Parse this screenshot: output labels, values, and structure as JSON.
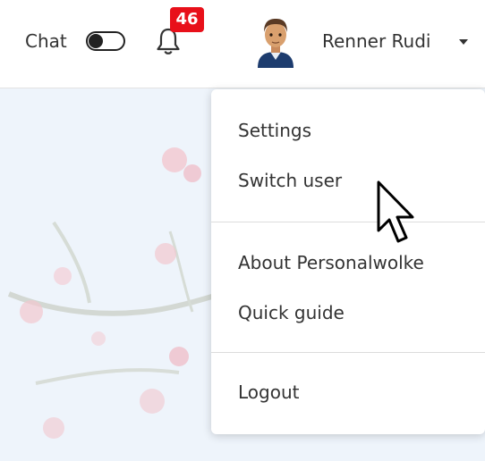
{
  "header": {
    "chat_label": "Chat",
    "chat_toggle_on": false,
    "notification_count": "46",
    "user_name": "Renner Rudi"
  },
  "colors": {
    "badge": "#e8101a",
    "background_tint": "#eef4fb",
    "blossom": "#f2c7cf"
  },
  "icons": {
    "notifications": "bell-icon",
    "user_menu": "caret-down-icon",
    "pointer": "mouse-pointer-icon"
  },
  "menu": {
    "settings": "Settings",
    "switch_user": "Switch user",
    "about": "About Personalwolke",
    "quick_guide": "Quick guide",
    "logout": "Logout"
  }
}
